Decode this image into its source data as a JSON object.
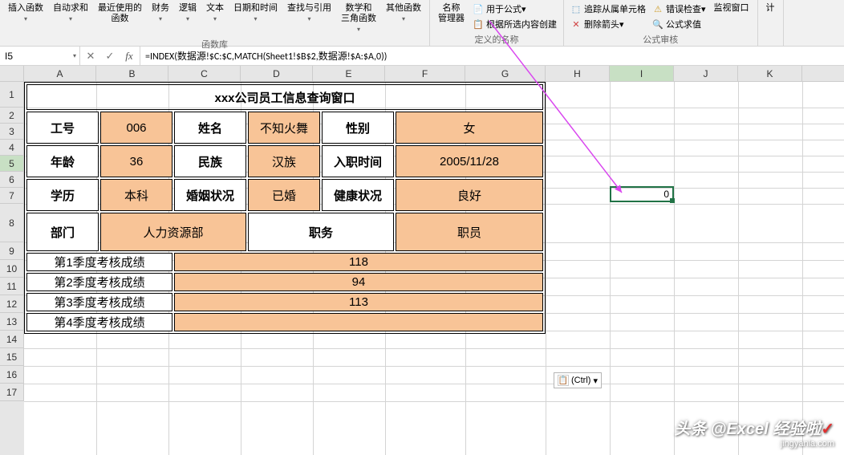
{
  "ribbon": {
    "group_fnlib": "函数库",
    "group_names": "定义的名称",
    "group_audit": "公式审核",
    "btns": {
      "insert_fn": "插入函数",
      "autosum": "自动求和",
      "recent": "最近使用的\n函数",
      "financial": "财务",
      "logical": "逻辑",
      "text": "文本",
      "datetime": "日期和时间",
      "lookup": "查找与引用",
      "math": "数学和\n三角函数",
      "other": "其他函数",
      "name_mgr": "名称\n管理器",
      "define_name": "用于公式",
      "create_sel": "根据所选内容创建",
      "trace_prec": "追踪从属单元格",
      "remove_arrows": "删除箭头",
      "error_check": "错误检查",
      "eval": "公式求值",
      "watch": "监视窗口",
      "calc": "计"
    }
  },
  "fbar": {
    "name": "I5",
    "formula": "=INDEX(数据源!$C:$C,MATCH(Sheet1!$B$2,数据源!$A:$A,0))"
  },
  "cols": [
    "A",
    "B",
    "C",
    "D",
    "E",
    "F",
    "G",
    "H",
    "I",
    "J",
    "K"
  ],
  "rowcount": 17,
  "table": {
    "title": "xxx公司员工信息查询窗口",
    "r2": {
      "c1": "工号",
      "c2": "006",
      "c3": "姓名",
      "c4": "不知火舞",
      "c5": "性别",
      "c6": "女"
    },
    "r4": {
      "c1": "年龄",
      "c2": "36",
      "c3": "民族",
      "c4": "汉族",
      "c5": "入职时间",
      "c6": "2005/11/28"
    },
    "r6": {
      "c1": "学历",
      "c2": "本科",
      "c3": "婚姻状况",
      "c4": "已婚",
      "c5": "健康状况",
      "c6": "良好"
    },
    "r8": {
      "c1": "部门",
      "c2": "人力资源部",
      "c3": "职务",
      "c4": "职员"
    },
    "scores": {
      "s1": {
        "lbl": "第1季度考核成绩",
        "val": "118"
      },
      "s2": {
        "lbl": "第2季度考核成绩",
        "val": "94"
      },
      "s3": {
        "lbl": "第3季度考核成绩",
        "val": "113"
      },
      "s4": {
        "lbl": "第4季度考核成绩",
        "val": ""
      }
    }
  },
  "active": {
    "value": "0"
  },
  "ctrl_tag": "(Ctrl)",
  "watermark": {
    "brand": "头条 @Excel 经验啦",
    "url": "jingyanla.com"
  }
}
